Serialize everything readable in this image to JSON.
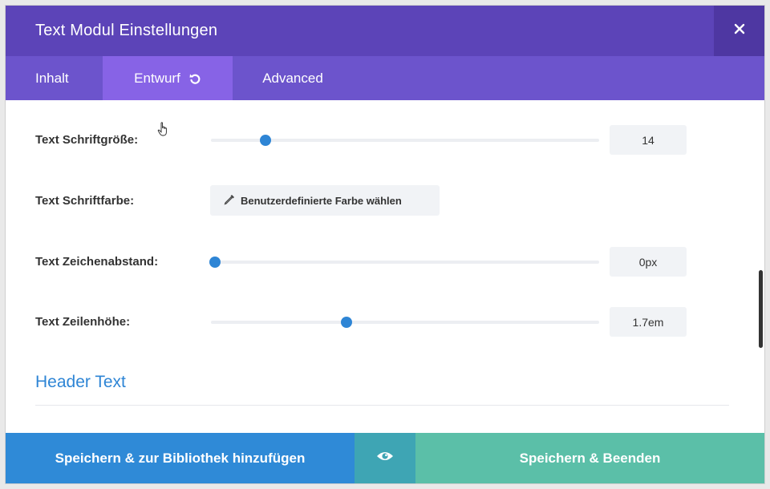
{
  "modal": {
    "title": "Text Modul Einstellungen",
    "close_icon": "close-icon"
  },
  "tabs": [
    {
      "label": "Inhalt",
      "active": false
    },
    {
      "label": "Entwurf",
      "active": true,
      "icon": "undo-icon"
    },
    {
      "label": "Advanced",
      "active": false
    }
  ],
  "settings": {
    "font_size": {
      "label": "Text Schriftgröße:",
      "value": "14",
      "slider_position": 0.14
    },
    "font_color": {
      "label": "Text Schriftfarbe:",
      "button_label": "Benutzerdefinierte Farbe wählen",
      "icon": "eyedropper-icon"
    },
    "letter_spacing": {
      "label": "Text Zeichenabstand:",
      "value": "0px",
      "slider_position": 0.01
    },
    "line_height": {
      "label": "Text Zeilenhöhe:",
      "value": "1.7em",
      "slider_position": 0.35
    }
  },
  "section": {
    "heading": "Header Text"
  },
  "footer": {
    "library_button": "Speichern & zur Bibliothek hinzufügen",
    "preview_icon": "eye-icon",
    "save_button": "Speichern & Beenden"
  },
  "colors": {
    "header": "#5c44b8",
    "tabs": "#6c54cc",
    "active_tab": "#8763e6",
    "accent": "#2e85d5",
    "save": "#5bbfa8"
  }
}
